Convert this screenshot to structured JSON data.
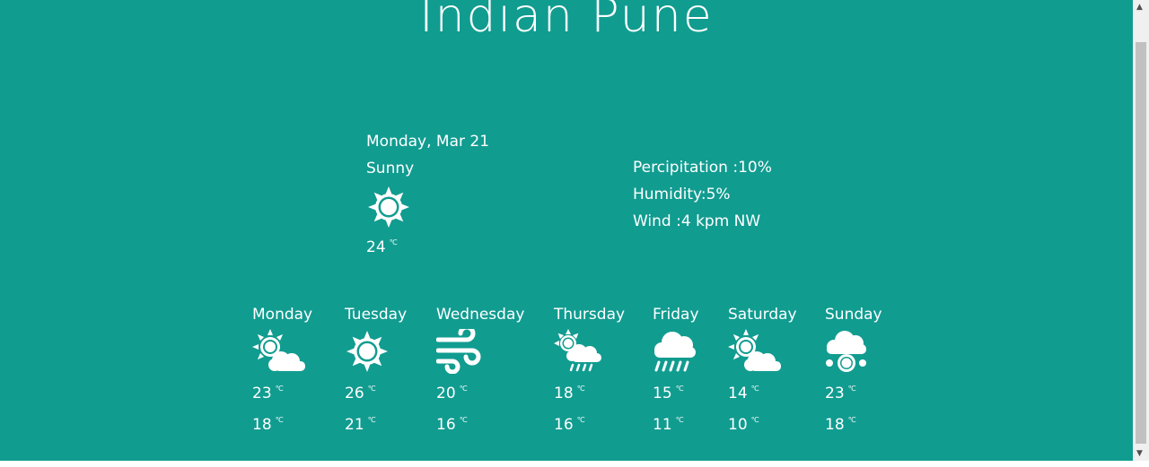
{
  "city": "Indian Pune",
  "today": {
    "date": "Monday, Mar 21",
    "condition": "Sunny",
    "icon": "sun-icon",
    "temp": "24",
    "unit": "℃"
  },
  "details": {
    "precipitation": "Percipitation :10%",
    "humidity": "Humidity:5%",
    "wind": "Wind :4 kpm NW"
  },
  "forecast": [
    {
      "day": "Monday",
      "icon": "partly-cloudy-icon",
      "high": "23",
      "low": "18",
      "unit": "℃"
    },
    {
      "day": "Tuesday",
      "icon": "sun-icon",
      "high": "26",
      "low": "21",
      "unit": "℃"
    },
    {
      "day": "Wednesday",
      "icon": "wind-icon",
      "high": "20",
      "low": "16",
      "unit": "℃"
    },
    {
      "day": "Thursday",
      "icon": "sun-rain-icon",
      "high": "18",
      "low": "16",
      "unit": "℃"
    },
    {
      "day": "Friday",
      "icon": "rain-icon",
      "high": "15",
      "low": "11",
      "unit": "℃"
    },
    {
      "day": "Saturday",
      "icon": "partly-cloudy-icon",
      "high": "14",
      "low": "10",
      "unit": "℃"
    },
    {
      "day": "Sunday",
      "icon": "snow-cloud-icon",
      "high": "23",
      "low": "18",
      "unit": "℃"
    }
  ],
  "colors": {
    "background": "#119c90",
    "text": "#ffffff",
    "scrollbar": "#c1c1c1"
  }
}
